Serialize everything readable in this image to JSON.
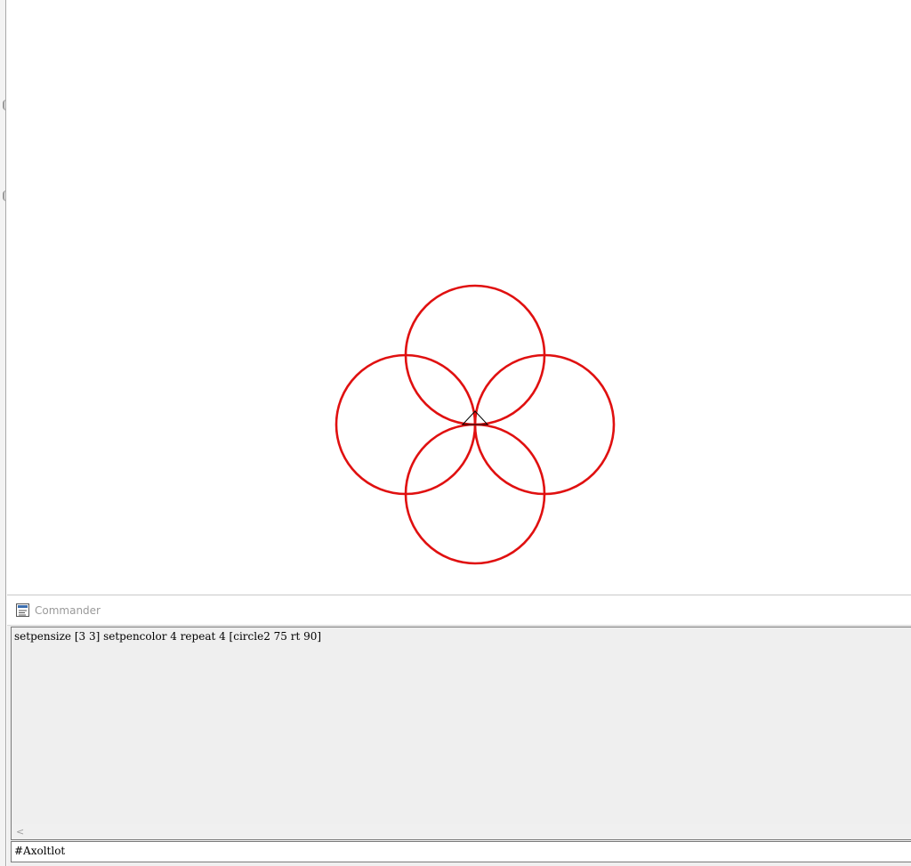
{
  "drawing": {
    "pen_color": "#e01010",
    "turtle_color": "#000000"
  },
  "commander": {
    "title": "Commander",
    "icon": "commander-window-icon",
    "history": [
      "setpensize [3 3] setpencolor 4 repeat 4 [circle2 75 rt 90]"
    ],
    "scroll_left_arrow": "<",
    "input_value": "#Axoltlot"
  }
}
